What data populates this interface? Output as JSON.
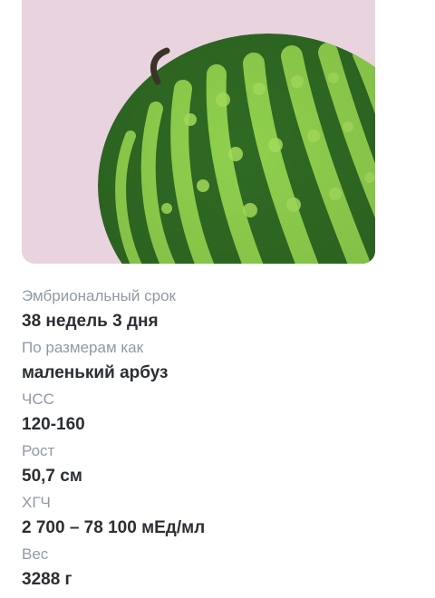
{
  "hero": {
    "image": "watermelon-image",
    "background_color": "#e9d3df"
  },
  "details": [
    {
      "label": "Эмбриональный срок",
      "value": "38 недель 3 дня"
    },
    {
      "label": "По размерам как",
      "value": "маленький арбуз"
    },
    {
      "label": "ЧСС",
      "value": "120-160"
    },
    {
      "label": "Рост",
      "value": "50,7 см"
    },
    {
      "label": "ХГЧ",
      "value": "2 700 – 78 100 мЕд/мл"
    },
    {
      "label": "Вес",
      "value": "3288 г"
    }
  ]
}
